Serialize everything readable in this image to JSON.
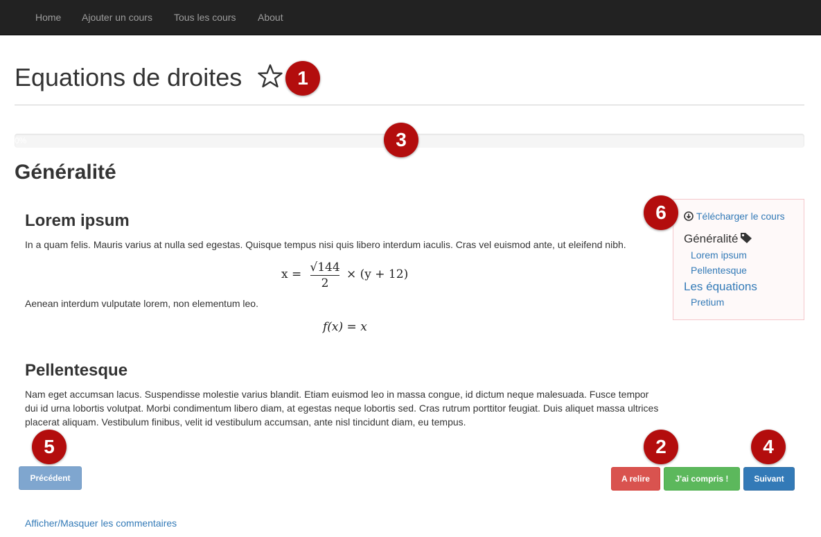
{
  "nav": {
    "items": [
      "Home",
      "Ajouter un cours",
      "Tous les cours",
      "About"
    ]
  },
  "page": {
    "title": "Equations de droites",
    "progress_label": "0%",
    "progress_value": 0
  },
  "section": {
    "title": "Généralité",
    "lorem": {
      "title": "Lorem ipsum",
      "para1": "In a quam felis. Mauris varius at nulla sed egestas. Quisque tempus nisi quis libero interdum iaculis. Cras vel euismod ante, ut eleifend nibh.",
      "equation1": {
        "lhs": "x =",
        "numerator": "√144",
        "denominator": "2",
        "rhs": "× (y + 12)"
      },
      "para2": "Aenean interdum vulputate lorem, non elementum leo.",
      "equation2": "f(x) = x"
    },
    "pellentesque": {
      "title": "Pellentesque",
      "para": "Nam eget accumsan lacus. Suspendisse molestie varius blandit. Etiam euismod leo in massa congue, id dictum neque malesuada. Fusce tempor dui id urna lobortis volutpat. Morbi condimentum libero diam, at egestas neque lobortis sed. Cras rutrum porttitor feugiat. Duis aliquet massa ultrices placerat aliquam. Vestibulum finibus, velit id vestibulum accumsan, ante nisl tincidunt diam, eu tempus."
    }
  },
  "sidebar": {
    "download": "Télécharger le cours",
    "heading1": "Généralité",
    "sub1": "Lorem ipsum",
    "sub2": "Pellentesque",
    "heading2": "Les équations",
    "sub3": "Pretium"
  },
  "buttons": {
    "previous": "Précédent",
    "reread": "A relire",
    "understood": "J'ai compris !",
    "next": "Suivant"
  },
  "footer": {
    "toggle_comments": "Afficher/Masquer les commentaires"
  },
  "markers": [
    "1",
    "2",
    "3",
    "4",
    "5",
    "6"
  ],
  "colors": {
    "navbar": "#222222",
    "link": "#337ab7",
    "danger": "#d9534f",
    "success": "#5cb85c",
    "primary": "#337ab7",
    "primary_disabled": "#7fa6cf",
    "marker": "#b30d0d"
  }
}
